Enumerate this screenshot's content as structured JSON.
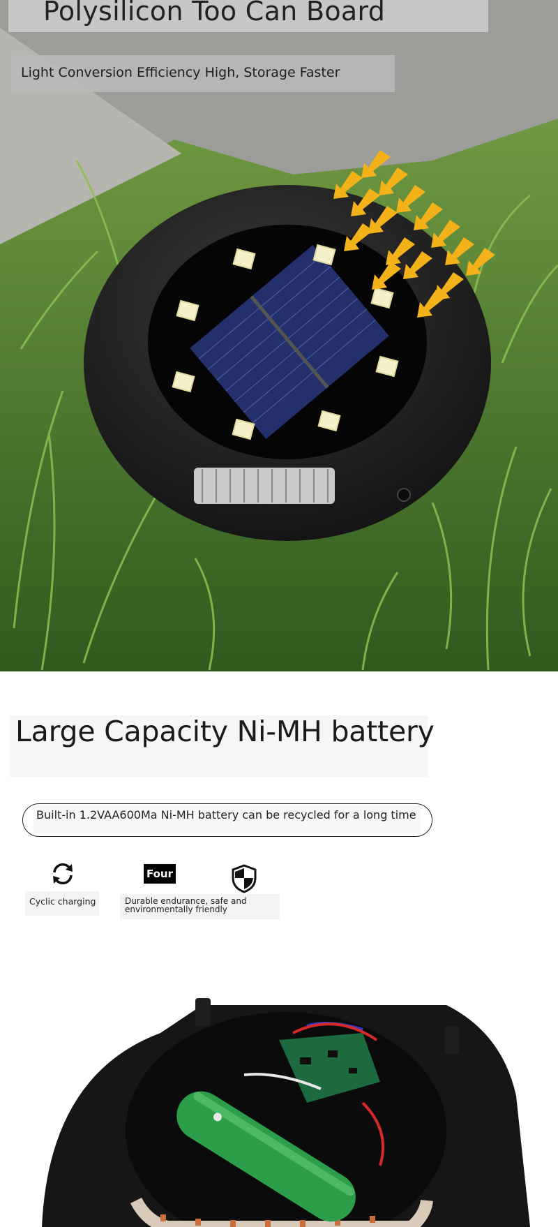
{
  "solar_section": {
    "title": "Polysilicon Too Can Board",
    "subtitle": "Light Conversion Efficiency High, Storage Faster"
  },
  "battery_section": {
    "heading": "Large Capacity Ni-MH battery",
    "description": "Built-in 1.2VAA600Ma Ni-MH battery can be recycled for a long time",
    "features": [
      {
        "icon": "cycle-arrows-icon",
        "label": "Cyclic charging"
      },
      {
        "icon": "four-badge-icon",
        "badge": "Four",
        "label": "Durable endurance, safe and environmentally friendly"
      },
      {
        "icon": "shield-icon"
      }
    ]
  },
  "colors": {
    "grass": "#4f7f32",
    "light_body": "#1c1c1c",
    "solar_panel": "#23306b",
    "arrow": "#f4b21a",
    "battery": "#2c9e4a"
  }
}
